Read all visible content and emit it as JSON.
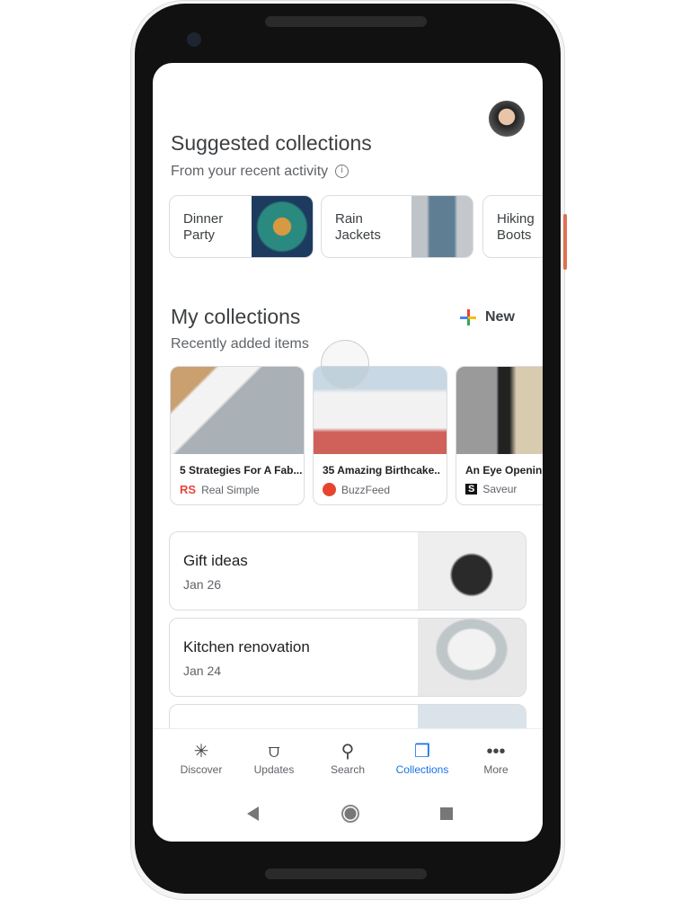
{
  "header": {
    "avatar": "user-avatar"
  },
  "suggested": {
    "title": "Suggested collections",
    "subtitle": "From your recent activity",
    "chips": [
      {
        "label": "Dinner Party"
      },
      {
        "label": "Rain Jackets"
      },
      {
        "label": "Hiking Boots"
      }
    ]
  },
  "my": {
    "title": "My collections",
    "new_label": "New",
    "subtitle": "Recently added items",
    "items": [
      {
        "title": "5 Strategies For A Fab...",
        "source": "Real Simple",
        "logo": "RS"
      },
      {
        "title": "35 Amazing Birthcake..",
        "source": "BuzzFeed"
      },
      {
        "title": "An Eye Openin",
        "source": "Saveur",
        "logo": "S"
      }
    ],
    "collections": [
      {
        "title": "Gift ideas",
        "date": "Jan 26"
      },
      {
        "title": "Kitchen renovation",
        "date": "Jan 24"
      }
    ]
  },
  "nav": [
    {
      "label": "Discover",
      "icon": "asterisk-icon"
    },
    {
      "label": "Updates",
      "icon": "updates-icon"
    },
    {
      "label": "Search",
      "icon": "search-icon"
    },
    {
      "label": "Collections",
      "icon": "collections-icon",
      "active": true
    },
    {
      "label": "More",
      "icon": "more-icon"
    }
  ],
  "colors": {
    "accent": "#1a73e8",
    "rs": "#e8453c",
    "buzzfeed": "#e5452f"
  }
}
